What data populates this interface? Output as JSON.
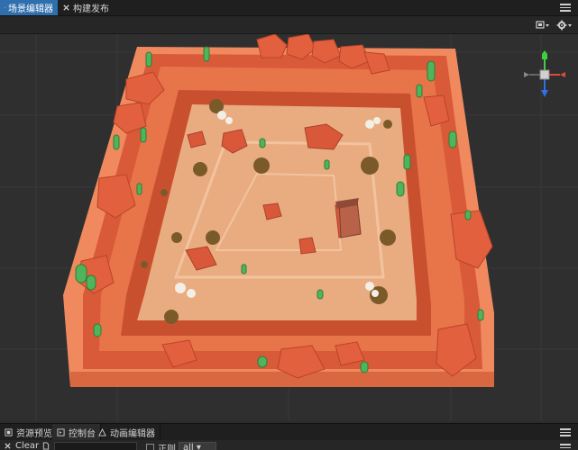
{
  "tabs": [
    {
      "label": "场景编辑器",
      "icon": "scene-icon",
      "active": true
    },
    {
      "label": "构建发布",
      "icon": "build-icon",
      "active": false
    }
  ],
  "toolbar": {
    "camera_icon": "camera-mode-icon",
    "settings_icon": "gear-icon"
  },
  "gizmo": {
    "axes": [
      "x",
      "y",
      "z"
    ],
    "colors": {
      "x": "#e04a3a",
      "y": "#3fcf3f",
      "z": "#2f6fe8"
    }
  },
  "bottom_tabs": [
    {
      "label": "资源预览",
      "icon": "asset-preview-icon",
      "active": false
    },
    {
      "label": "控制台",
      "icon": "console-icon",
      "active": true
    },
    {
      "label": "动画编辑器",
      "icon": "animation-icon",
      "active": false
    }
  ],
  "console_toolbar": {
    "clear_label": "Clear",
    "search_value": "",
    "regex_label": "正则",
    "filter_value": "all"
  },
  "colors": {
    "accent": "#2f6fae",
    "panel": "#2b2b2b",
    "sand": "#e9ac80",
    "rock": "#e0603f",
    "cactus": "#4fb45a"
  }
}
